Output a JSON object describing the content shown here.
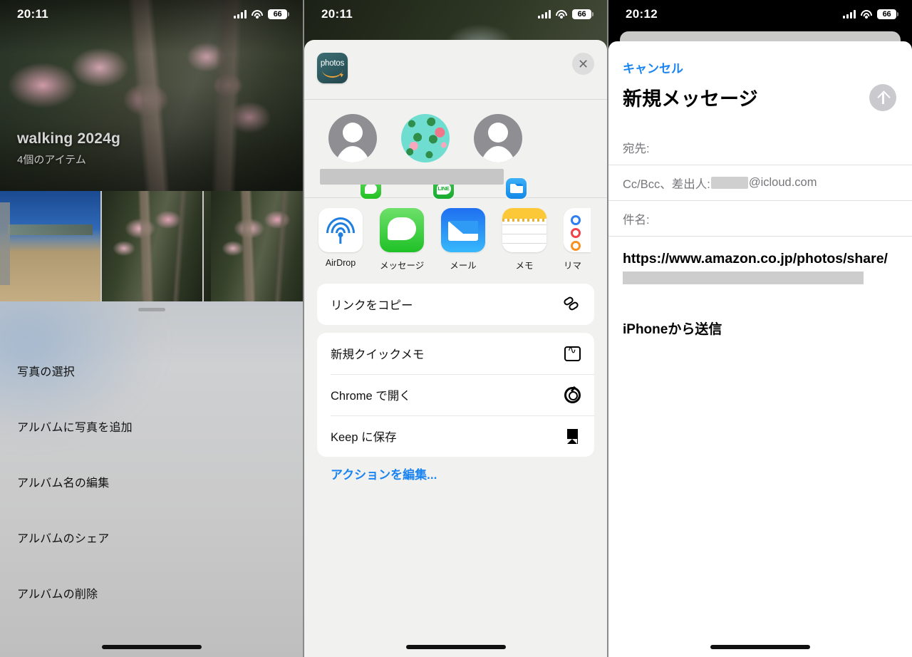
{
  "panels": {
    "left": {
      "statusbar": {
        "time": "20:11",
        "battery": "66",
        "signal_icon": "cellular-signal-icon",
        "wifi_icon": "wifi-icon",
        "battery_icon": "battery-icon"
      },
      "album": {
        "title": "walking 2024g",
        "count": "4個のアイテム"
      },
      "menu_items": [
        {
          "label": "写真の選択"
        },
        {
          "label": "アルバムに写真を追加"
        },
        {
          "label": "アルバム名の編集"
        },
        {
          "label": "アルバムのシェア"
        },
        {
          "label": "アルバムの削除"
        }
      ]
    },
    "middle": {
      "statusbar": {
        "time": "20:11",
        "battery": "66"
      },
      "share_sheet": {
        "app_icon_name": "amazon-photos-icon",
        "app_icon_text": "photos",
        "close_label": "✕",
        "contacts": [
          {
            "avatar": "person-placeholder-avatar",
            "badge": "messages-badge"
          },
          {
            "avatar": "frog-pattern-avatar",
            "badge": "line-badge",
            "badge_text": "LINE"
          },
          {
            "avatar": "person-placeholder-avatar",
            "badge": "mail-badge"
          }
        ],
        "apps": [
          {
            "label": "AirDrop",
            "icon": "airdrop-icon"
          },
          {
            "label": "メッセージ",
            "icon": "messages-icon"
          },
          {
            "label": "メール",
            "icon": "mail-icon"
          },
          {
            "label": "メモ",
            "icon": "notes-icon"
          },
          {
            "label": "リマ",
            "icon": "reminders-icon"
          }
        ],
        "action_groups": [
          [
            {
              "label": "リンクをコピー",
              "icon": "link-icon"
            }
          ],
          [
            {
              "label": "新規クイックメモ",
              "icon": "quick-note-icon"
            },
            {
              "label": "Chrome で開く",
              "icon": "chrome-icon"
            },
            {
              "label": "Keep に保存",
              "icon": "bookmark-icon"
            }
          ]
        ],
        "edit_actions_label": "アクションを編集..."
      }
    },
    "right": {
      "statusbar": {
        "time": "20:12",
        "battery": "66"
      },
      "compose": {
        "cancel_label": "キャンセル",
        "title": "新規メッセージ",
        "send_icon": "send-arrow-up-icon",
        "to_label": "宛先:",
        "cc_label": "Cc/Bcc、差出人:",
        "cc_domain": "@icloud.com",
        "subject_label": "件名:",
        "body_url": "https://www.amazon.co.jp/photos/share/",
        "signature": "iPhoneから送信"
      }
    }
  },
  "colors": {
    "accent_blue": "#1a84f0",
    "sheet_bg": "#f1f1ef",
    "card_white": "#ffffff",
    "left_sheet": "#c9c9c9"
  }
}
